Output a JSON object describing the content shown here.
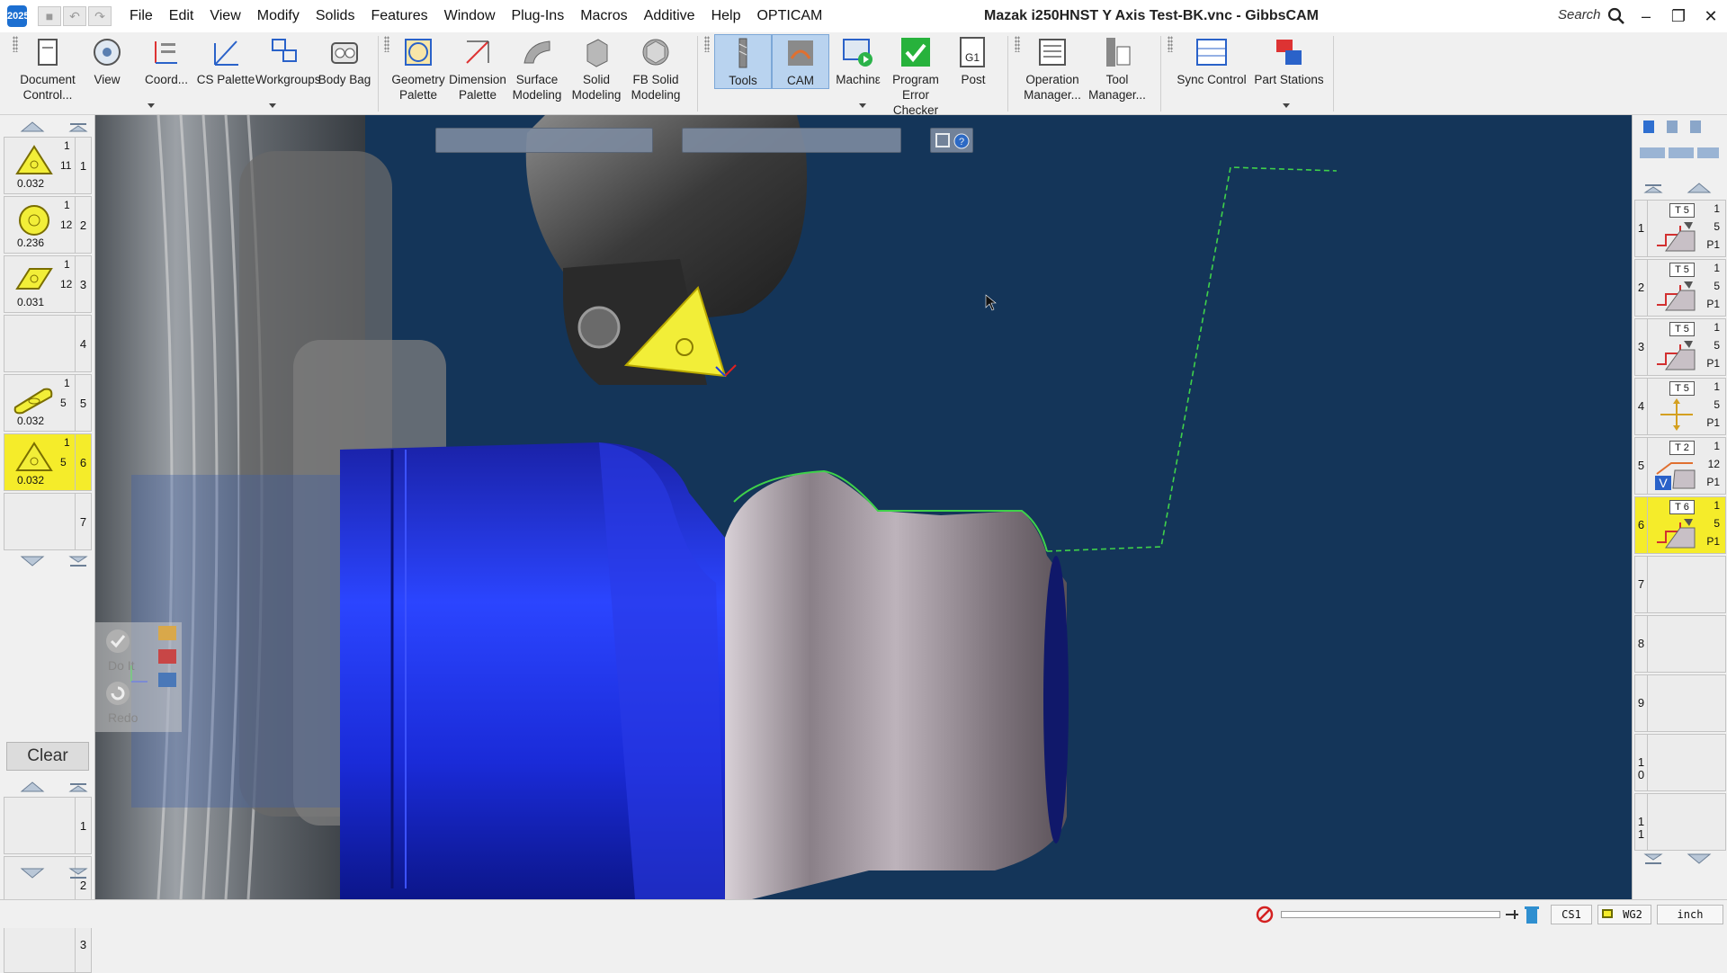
{
  "titlebar": {
    "app_icon_text": "2025",
    "title": "Mazak i250HNST Y Axis Test-BK.vnc - GibbsCAM",
    "search_label": "Search",
    "quick_access": [
      "save-icon",
      "undo-icon",
      "redo-icon"
    ],
    "window_controls": [
      "minimize",
      "restore",
      "close"
    ]
  },
  "menu": [
    "File",
    "Edit",
    "View",
    "Modify",
    "Solids",
    "Features",
    "Window",
    "Plug-Ins",
    "Macros",
    "Additive",
    "Help",
    "OPTICAM"
  ],
  "ribbon": {
    "group1": [
      {
        "label": "Document Control...",
        "icon": "document-control-icon"
      },
      {
        "label": "View",
        "icon": "view-icon"
      },
      {
        "label": "Coord...",
        "icon": "coord-icon"
      },
      {
        "label": "CS Palette",
        "icon": "cs-palette-icon"
      },
      {
        "label": "Workgroups",
        "icon": "workgroups-icon"
      },
      {
        "label": "Body Bag",
        "icon": "body-bag-icon"
      }
    ],
    "group2": [
      {
        "label": "Geometry Palette",
        "icon": "geometry-palette-icon"
      },
      {
        "label": "Dimension Palette",
        "icon": "dimension-palette-icon"
      },
      {
        "label": "Surface Modeling",
        "icon": "surface-modeling-icon"
      },
      {
        "label": "Solid Modeling",
        "icon": "solid-modeling-icon"
      },
      {
        "label": "FB Solid Modeling",
        "icon": "fb-solid-modeling-icon"
      }
    ],
    "group3": [
      {
        "label": "Tools",
        "icon": "tools-icon",
        "active": true
      },
      {
        "label": "CAM",
        "icon": "cam-icon",
        "active": true
      },
      {
        "label": "Machinε",
        "icon": "machine-icon"
      },
      {
        "label": "Program Error Checker",
        "icon": "checkmark-icon"
      },
      {
        "label": "Post",
        "icon": "post-icon"
      }
    ],
    "group4": [
      {
        "label": "Operation Manager...",
        "icon": "operation-manager-icon"
      },
      {
        "label": "Tool Manager...",
        "icon": "tool-manager-icon"
      }
    ],
    "group5": [
      {
        "label": "Sync Control",
        "icon": "sync-control-icon"
      },
      {
        "label": "Part Stations",
        "icon": "part-stations-icon"
      }
    ]
  },
  "tools_list": [
    {
      "num": "1",
      "top": "1",
      "mid": "11",
      "dia": "0.032",
      "shape": "triangle",
      "selected": false
    },
    {
      "num": "2",
      "top": "1",
      "mid": "12",
      "dia": "0.236",
      "shape": "round",
      "selected": false
    },
    {
      "num": "3",
      "top": "1",
      "mid": "12",
      "dia": "0.031",
      "shape": "diamond",
      "selected": false
    },
    {
      "num": "4",
      "top": "",
      "mid": "",
      "dia": "",
      "shape": "none",
      "selected": false
    },
    {
      "num": "5",
      "top": "1",
      "mid": "5",
      "dia": "0.032",
      "shape": "groove",
      "selected": false
    },
    {
      "num": "6",
      "top": "1",
      "mid": "5",
      "dia": "0.032",
      "shape": "triangle",
      "selected": true
    },
    {
      "num": "7",
      "top": "",
      "mid": "",
      "dia": "",
      "shape": "none",
      "selected": false
    }
  ],
  "clear_label": "Clear",
  "process_slots": [
    "1",
    "2",
    "3"
  ],
  "doit": {
    "do_it": "Do It",
    "redo": "Redo"
  },
  "operations": [
    {
      "num": "1",
      "tool": "T 5",
      "top": "1",
      "mid": "5",
      "bot": "P1",
      "selected": false,
      "icon": "rough-turn-icon"
    },
    {
      "num": "2",
      "tool": "T 5",
      "top": "1",
      "mid": "5",
      "bot": "P1",
      "selected": false,
      "icon": "rough-turn-icon"
    },
    {
      "num": "3",
      "tool": "T 5",
      "top": "1",
      "mid": "5",
      "bot": "P1",
      "selected": false,
      "icon": "rough-turn-icon"
    },
    {
      "num": "4",
      "tool": "T 5",
      "top": "1",
      "mid": "5",
      "bot": "P1",
      "selected": false,
      "icon": "move-icon"
    },
    {
      "num": "5",
      "tool": "T 2",
      "top": "1",
      "mid": "12",
      "bot": "P1",
      "selected": false,
      "icon": "contour-v-icon"
    },
    {
      "num": "6",
      "tool": "T 6",
      "top": "1",
      "mid": "5",
      "bot": "P1",
      "selected": true,
      "icon": "contour-turn-icon"
    },
    {
      "num": "7",
      "tool": "",
      "top": "",
      "mid": "",
      "bot": "",
      "selected": false
    },
    {
      "num": "8",
      "tool": "",
      "top": "",
      "mid": "",
      "bot": "",
      "selected": false
    },
    {
      "num": "9",
      "tool": "",
      "top": "",
      "mid": "",
      "bot": "",
      "selected": false
    },
    {
      "num": "1\n0",
      "tool": "",
      "top": "",
      "mid": "",
      "bot": "",
      "selected": false
    },
    {
      "num": "1\n1",
      "tool": "",
      "top": "",
      "mid": "",
      "bot": "",
      "selected": false
    }
  ],
  "statusbar": {
    "cs": "CS1",
    "wg": "WG2",
    "units": "inch"
  },
  "colors": {
    "viewport_bg": "#143559",
    "selection_yellow": "#f5ec2a",
    "stock_blue": "#1f2fd6",
    "part_silver": "#a89ea6",
    "toolpath_green": "#3fd14a"
  }
}
